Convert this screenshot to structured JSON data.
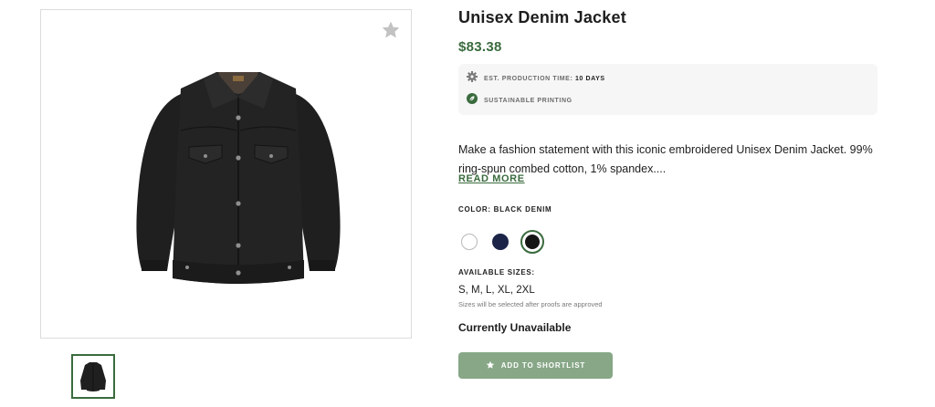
{
  "product": {
    "title": "Unisex Denim Jacket",
    "price": "$83.38",
    "favorite_icon": "star-icon"
  },
  "info": {
    "production_label": "EST. PRODUCTION TIME:",
    "production_value": "10 DAYS",
    "production_icon": "gear-icon",
    "sustainable_label": "SUSTAINABLE PRINTING",
    "sustainable_icon": "leaf-icon"
  },
  "description": {
    "text": "Make a fashion statement with this iconic embroidered Unisex Denim Jacket. 99% ring-spun combed cotton, 1% spandex....",
    "read_more": "READ MORE"
  },
  "color": {
    "label": "COLOR: BLACK DENIM",
    "options": [
      {
        "name": "White",
        "hex": "#ffffff"
      },
      {
        "name": "Navy",
        "hex": "#1c2548"
      },
      {
        "name": "Black Denim",
        "hex": "#151515",
        "selected": true
      }
    ]
  },
  "sizes": {
    "label": "AVAILABLE SIZES:",
    "values": "S, M, L, XL, 2XL",
    "note": "Sizes will be selected after proofs are approved"
  },
  "availability": "Currently Unavailable",
  "actions": {
    "shortlist_label": "ADD TO SHORTLIST",
    "shortlist_icon": "star-icon"
  },
  "colors": {
    "accent": "#3a6b3e",
    "button": "#87a787",
    "info_bg": "#f6f6f6"
  }
}
